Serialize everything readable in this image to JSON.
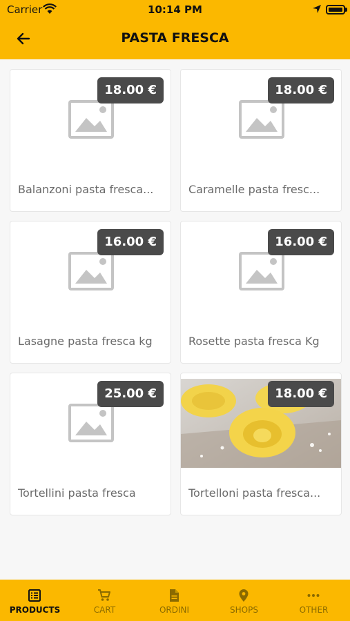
{
  "status": {
    "carrier": "Carrier",
    "time": "10:14 PM"
  },
  "header": {
    "title": "PASTA FRESCA"
  },
  "products": [
    {
      "name": "Balanzoni pasta fresca...",
      "price": "18.00 €"
    },
    {
      "name": "Caramelle pasta fresc...",
      "price": "18.00 €"
    },
    {
      "name": "Lasagne pasta fresca kg",
      "price": "16.00 €"
    },
    {
      "name": "Rosette pasta fresca Kg",
      "price": "16.00 €"
    },
    {
      "name": "Tortellini pasta fresca",
      "price": "25.00 €"
    },
    {
      "name": "Tortelloni pasta fresca...",
      "price": "18.00 €"
    }
  ],
  "tabs": [
    {
      "label": "PRODUCTS",
      "icon": "list-icon",
      "active": true
    },
    {
      "label": "CART",
      "icon": "cart-icon",
      "active": false
    },
    {
      "label": "ORDINI",
      "icon": "document-icon",
      "active": false
    },
    {
      "label": "SHOPS",
      "icon": "location-pin-icon",
      "active": false
    },
    {
      "label": "OTHER",
      "icon": "more-dots-icon",
      "active": false
    }
  ],
  "colors": {
    "accent": "#fbb800",
    "price_badge": "#4a4a4a",
    "background": "#f7f7f7"
  }
}
